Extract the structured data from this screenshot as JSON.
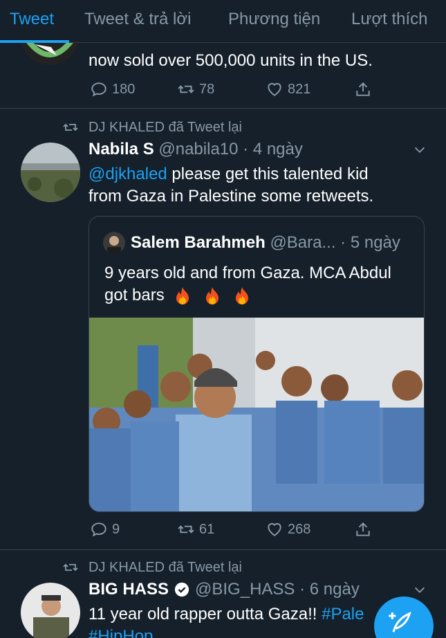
{
  "tabs": [
    "Tweet",
    "Tweet & trả lời",
    "Phương tiện",
    "Lượt thích"
  ],
  "tweet1": {
    "text": "now sold over 500,000 units in the US.",
    "replies": "180",
    "retweets": "78",
    "likes": "821"
  },
  "tweet2": {
    "retweeted_by": "DJ KHALED đã Tweet lại",
    "name": "Nabila S",
    "handle": "@nabila10 · 4 ngày",
    "mention": "@djkhaled",
    "text_line1_rest": " please get this talented kid",
    "text_line2": "from Gaza in Palestine some retweets.",
    "quote": {
      "name": "Salem Barahmeh",
      "handle": "@Bara... · 5 ngày",
      "text_line1": "9 years old and from Gaza. MCA Abdul",
      "text_line2": "got bars"
    },
    "replies": "9",
    "retweets": "61",
    "likes": "268"
  },
  "tweet3": {
    "retweeted_by": "DJ KHALED đã Tweet lại",
    "name": "BIG HASS",
    "handle": "@BIG_HASS · 6 ngày",
    "text": "11 year old rapper outta Gaza!! ",
    "hashtag1": "#Pale",
    "hashtag2": "#HipHop"
  },
  "colors": {
    "background": "#15202b",
    "accent": "#1da1f2",
    "muted": "#8899a6",
    "divider": "#38444d"
  }
}
